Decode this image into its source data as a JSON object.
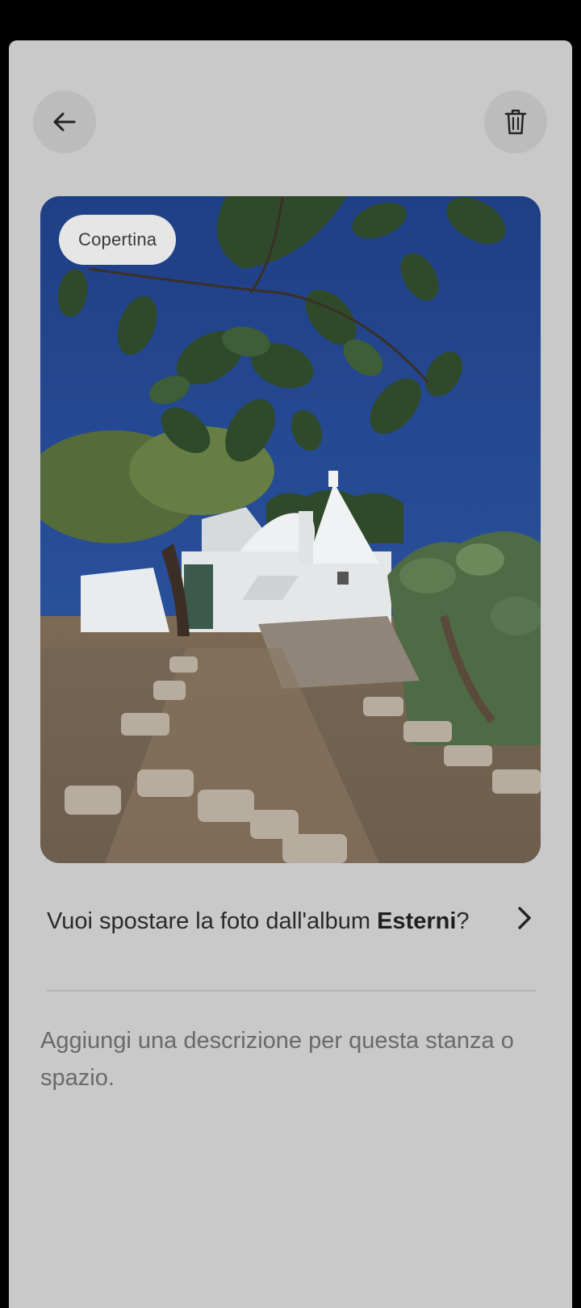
{
  "header": {
    "back_icon": "arrow-left-icon",
    "delete_icon": "trash-icon"
  },
  "photo": {
    "badge_label": "Copertina",
    "description": "Trullo photo"
  },
  "move_prompt": {
    "text_before": "Vuoi spostare la foto dall'album ",
    "album_name": "Esterni",
    "text_after": "?",
    "chevron_icon": "chevron-right-icon"
  },
  "description_field": {
    "placeholder": "Aggiungi una descrizione per questa stanza o spazio."
  },
  "colors": {
    "sheet_background": "#c9c9c9",
    "button_background": "#bcbcbc",
    "pill_background": "#e6e6e6"
  }
}
